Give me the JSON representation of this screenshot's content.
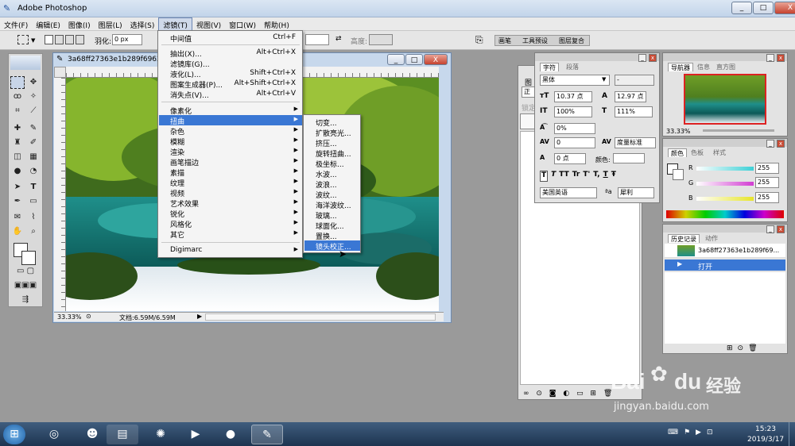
{
  "app": {
    "title": "Adobe Photoshop",
    "win_min": "_",
    "win_max": "□",
    "win_close": "X"
  },
  "menubar": [
    "文件(F)",
    "编辑(E)",
    "图像(I)",
    "图层(L)",
    "选择(S)",
    "滤镜(T)",
    "视图(V)",
    "窗口(W)",
    "帮助(H)"
  ],
  "options": {
    "feather_label": "羽化:",
    "feather_value": "0 px",
    "height_label": "高度:",
    "dock_tabs": [
      "画笔",
      "工具预设",
      "图层复合"
    ]
  },
  "document": {
    "title": "3a68ff27363e1b289f6962",
    "zoom": "33.33%",
    "doc_info": "文档:6.59M/6.59M"
  },
  "filter_menu": {
    "top_items": [
      {
        "label": "中间值",
        "shortcut": "Ctrl+F"
      }
    ],
    "group2": [
      {
        "label": "抽出(X)...",
        "shortcut": "Alt+Ctrl+X"
      },
      {
        "label": "滤镜库(G)...",
        "shortcut": ""
      },
      {
        "label": "液化(L)...",
        "shortcut": "Shift+Ctrl+X"
      },
      {
        "label": "图案生成器(P)...",
        "shortcut": "Alt+Shift+Ctrl+X"
      },
      {
        "label": "消失点(V)...",
        "shortcut": "Alt+Ctrl+V"
      }
    ],
    "group3": [
      "像素化",
      "扭曲",
      "杂色",
      "模糊",
      "渲染",
      "画笔描边",
      "素描",
      "纹理",
      "视频",
      "艺术效果",
      "锐化",
      "风格化",
      "其它"
    ],
    "highlighted": "扭曲",
    "group4": [
      "Digimarc"
    ]
  },
  "distort_submenu": {
    "items": [
      "切变...",
      "扩散亮光...",
      "挤压...",
      "旋转扭曲...",
      "极坐标...",
      "水波...",
      "波浪...",
      "波纹...",
      "海洋波纹...",
      "玻璃...",
      "球面化...",
      "置换...",
      "镜头校正..."
    ],
    "highlighted": "镜头校正..."
  },
  "layers_panel": {
    "tab_fragment": "图",
    "mode_fragment": "正",
    "lock_fragment": "锁定"
  },
  "char_panel": {
    "tabs": [
      "字符",
      "段落"
    ],
    "font_family": "黑体",
    "font_style": "-",
    "font_size": "10.37 点",
    "leading": "12.97 点",
    "vscale": "100%",
    "hscale": "111%",
    "tracking": "0%",
    "kerning": "0",
    "kerning_mode": "度量标准",
    "baseline": "0 点",
    "color_label": "颜色:",
    "style_buttons": [
      "T",
      "T",
      "TT",
      "Tr",
      "T'",
      "T,",
      "T",
      "Ŧ"
    ],
    "language": "美国英语",
    "aa_label": "ªa",
    "aa_value": "犀利"
  },
  "navigator_panel": {
    "tabs": [
      "导航器",
      "信息",
      "直方图"
    ],
    "zoom": "33.33%"
  },
  "color_panel": {
    "tabs": [
      "颜色",
      "色板",
      "样式"
    ],
    "channels": [
      {
        "name": "R",
        "value": "255",
        "color": "#3cd0d6"
      },
      {
        "name": "G",
        "value": "255",
        "color": "#d23dd2"
      },
      {
        "name": "B",
        "value": "255",
        "color": "#e7e52a"
      }
    ]
  },
  "history_panel": {
    "tabs": [
      "历史记录",
      "动作"
    ],
    "snapshot": "3a68ff27363e1b289f69...",
    "states": [
      "打开"
    ]
  },
  "taskbar": {
    "time": "15:23",
    "date": "2019/3/17"
  },
  "watermark": {
    "brand": "Bai",
    "brand_suffix": "du",
    "cn": "经验",
    "url": "jingyan.baidu.com"
  },
  "colors": {
    "accent": "#3a77d4",
    "taskbar": "#1d3450"
  }
}
